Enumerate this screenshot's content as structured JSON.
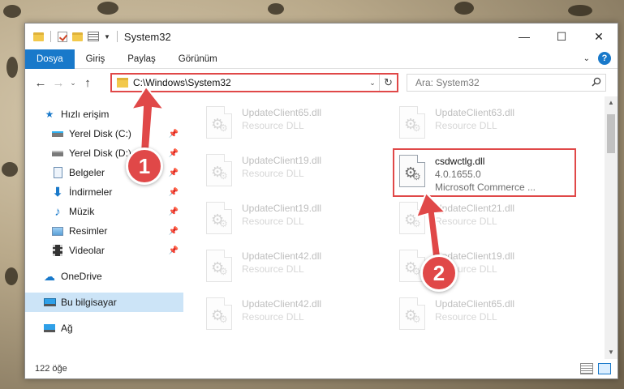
{
  "window": {
    "title": "System32"
  },
  "window_controls": {
    "minimize": "—",
    "maximize": "☐",
    "close": "✕"
  },
  "ribbon": {
    "tabs": [
      "Dosya",
      "Giriş",
      "Paylaş",
      "Görünüm"
    ],
    "help": "?"
  },
  "address": {
    "path": "C:\\Windows\\System32",
    "search_placeholder": "Ara: System32"
  },
  "nav": {
    "quick_access": "Hızlı erişim",
    "items": [
      {
        "label": "Yerel Disk (C:)"
      },
      {
        "label": "Yerel Disk (D:)"
      },
      {
        "label": "Belgeler"
      },
      {
        "label": "İndirmeler"
      },
      {
        "label": "Müzik"
      },
      {
        "label": "Resimler"
      },
      {
        "label": "Videolar"
      }
    ],
    "onedrive": "OneDrive",
    "this_pc": "Bu bilgisayar",
    "network": "Ağ"
  },
  "files": [
    {
      "name": "UpdateClient65.dll",
      "sub1": "Resource DLL"
    },
    {
      "name": "UpdateClient63.dll",
      "sub1": "Resource DLL"
    },
    {
      "name": "UpdateClient19.dll",
      "sub1": "Resource DLL"
    },
    {
      "name": "csdwctlg.dll",
      "sub1": "4.0.1655.0",
      "sub2": "Microsoft Commerce ..."
    },
    {
      "name": "UpdateClient19.dll",
      "sub1": "Resource DLL"
    },
    {
      "name": "UpdateClient21.dll",
      "sub1": "Resource DLL"
    },
    {
      "name": "UpdateClient42.dll",
      "sub1": "Resource DLL"
    },
    {
      "name": "UpdateClient19.dll",
      "sub1": "Resource DLL"
    },
    {
      "name": "UpdateClient42.dll",
      "sub1": "Resource DLL"
    },
    {
      "name": "UpdateClient65.dll",
      "sub1": "Resource DLL"
    }
  ],
  "status": {
    "count": "122 öğe"
  },
  "callouts": {
    "one": "1",
    "two": "2"
  },
  "colors": {
    "accent": "#1979ca",
    "highlight": "#e04848",
    "selected": "#cce4f7"
  },
  "icons": {
    "back": "←",
    "forward": "→",
    "up": "↑",
    "dropdown": "⌄",
    "refresh": "↻",
    "search": "⌕",
    "pin": "📌"
  }
}
